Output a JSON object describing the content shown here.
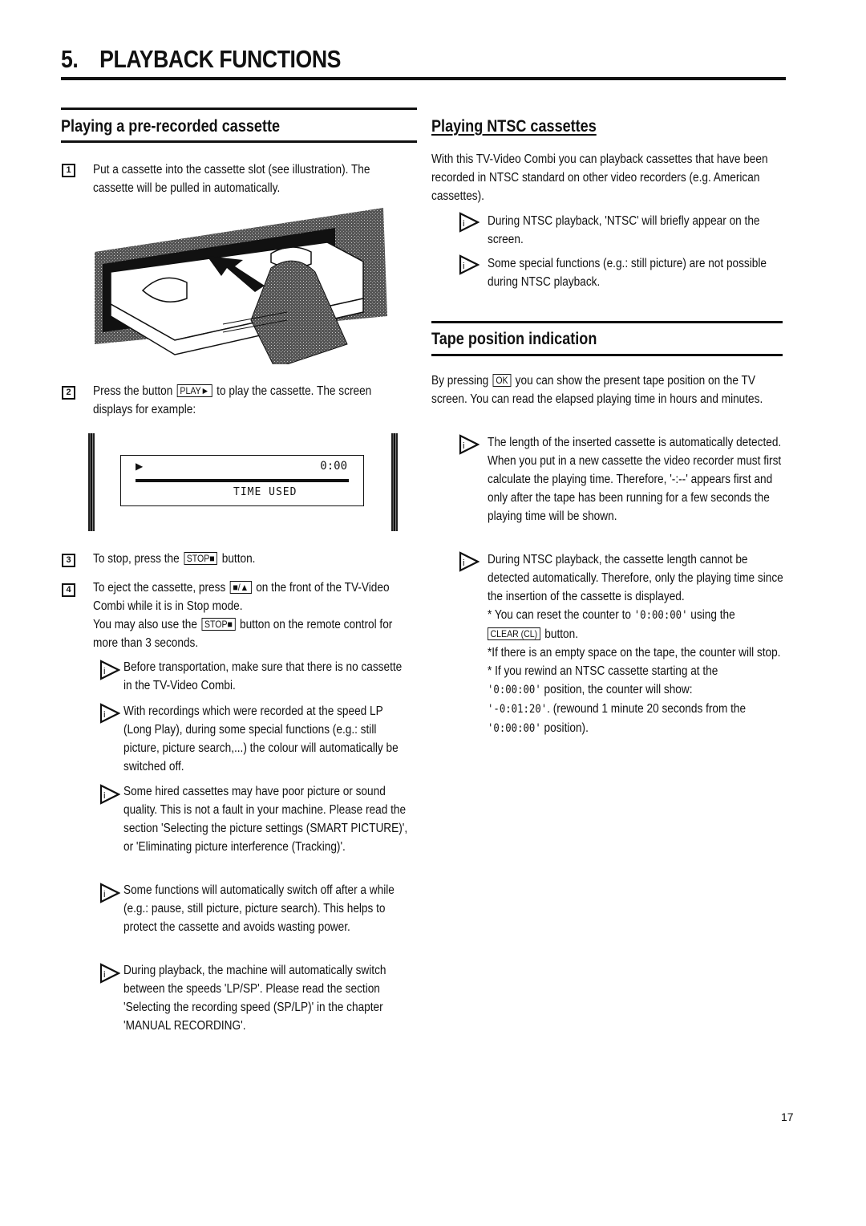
{
  "chapter": {
    "number": "5.",
    "title": "PLAYBACK FUNCTIONS"
  },
  "left": {
    "heading": "Playing a pre-recorded cassette",
    "step1": {
      "num": "1",
      "text": "Put a cassette into the cassette slot (see illustration). The cassette will be pulled in automatically."
    },
    "illustration": "cassette-insertion-illustration",
    "step2": {
      "num": "2",
      "pre": "Press the button",
      "key": "PLAY►",
      "post": "to play the cassette. The screen displays for example:"
    },
    "screen": {
      "play_symbol": "▶",
      "time": "0:00",
      "label": "TIME USED"
    },
    "step3": {
      "num": "3",
      "pre": "To stop, press the",
      "key": "STOP■",
      "post": "button."
    },
    "step4": {
      "num": "4",
      "pre": "To eject the cassette, press",
      "key": "■/▲",
      "post": "on the front of the TV-Video Combi while it is in Stop mode.",
      "pre2": "You may also use the",
      "key2": "STOP■",
      "post2": "button on the remote control for more than 3 seconds."
    },
    "notes": [
      "Before transportation, make sure that there is no cassette in the TV-Video Combi.",
      "With recordings which were recorded at the speed LP (Long Play), during some special functions (e.g.: still picture, picture search,...) the colour will automatically be switched off.",
      "Some hired cassettes may have poor picture or sound quality. This is not a fault in your machine. Please read the section 'Selecting the picture settings (SMART PICTURE)', or 'Eliminating picture interference (Tracking)'.",
      "Some functions will automatically switch off after a while (e.g.: pause, still picture, picture search). This helps to protect the cassette and avoids wasting power.",
      "During playback, the machine will automatically switch between the speeds 'LP/SP'. Please read the section 'Selecting the recording speed (SP/LP)' in the chapter 'MANUAL RECORDING'."
    ]
  },
  "right": {
    "ntsc": {
      "heading": "Playing NTSC cassettes",
      "intro": "With this TV-Video Combi you can playback cassettes that have been recorded in NTSC standard on other video recorders (e.g. American cassettes).",
      "notes": [
        "During NTSC playback, 'NTSC' will briefly appear on the screen.",
        "Some special functions (e.g.: still picture) are not possible during NTSC playback."
      ]
    },
    "tape": {
      "heading": "Tape position indication",
      "intro_pre": "By pressing",
      "intro_key": "OK",
      "intro_post": "you can show the present tape position on the TV screen. You can read the elapsed playing time in hours and minutes.",
      "note1": "The length of the inserted cassette is automatically detected. When you put in a new cassette the video recorder must first calculate the playing time. Therefore, '-:--' appears first and only after the tape has been running for a few seconds the playing time will be shown.",
      "note2": "During NTSC playback, the cassette length cannot be detected automatically. Therefore, only the playing time since the insertion of the cassette is displayed.",
      "bullet1_pre": "* You can reset the counter to ",
      "bullet1_code": "'0:00:00'",
      "bullet1_post": " using the",
      "bullet1_key": "CLEAR (CL)",
      "bullet1_end": "button.",
      "bullet2": "*If there is an empty space on the tape, the counter will stop.",
      "bullet3_pre": "* If you rewind an NTSC cassette starting at the",
      "bullet3_code1": "'0:00:00'",
      "bullet3_mid": " position, the counter will show:",
      "bullet3_code2": "'-0:01:20'",
      "bullet3_post": ". (rewound 1 minute 20 seconds from the ",
      "bullet3_code3": "'0:00:00'",
      "bullet3_end": " position)."
    }
  },
  "page_number": "17"
}
